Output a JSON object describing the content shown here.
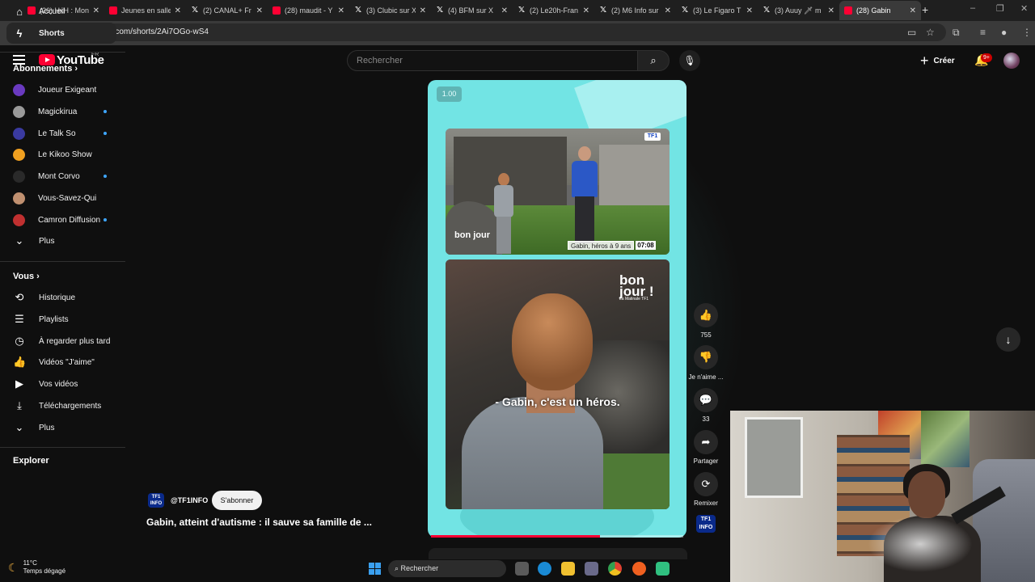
{
  "browser": {
    "tabs": [
      {
        "title": "(26) HxH : Mon",
        "icon": "youtube"
      },
      {
        "title": "Jeunes en salle",
        "icon": "youtube"
      },
      {
        "title": "(2) CANAL+ Fr",
        "icon": "x"
      },
      {
        "title": "(28) maudit - Y",
        "icon": "youtube"
      },
      {
        "title": "(3) Clubic sur X",
        "icon": "x"
      },
      {
        "title": "(4) BFM sur X",
        "icon": "x"
      },
      {
        "title": "(2) Le20h-Fran",
        "icon": "x"
      },
      {
        "title": "(2) M6 Info sur",
        "icon": "x"
      },
      {
        "title": "(3) Le Figaro T",
        "icon": "x"
      },
      {
        "title": "(3) Auuy 🗡 m",
        "icon": "x"
      },
      {
        "title": "(28) Gabin",
        "icon": "youtube",
        "active": true
      }
    ],
    "url": "youtube.com/shorts/2Ai7OGo-wS4"
  },
  "header": {
    "logo_text": "YouTube",
    "country": "FR",
    "search_placeholder": "Rechercher",
    "create_label": "Créer",
    "notif_badge": "9+"
  },
  "sidebar": {
    "main": [
      {
        "label": "Accueil",
        "icon": "home-icon"
      },
      {
        "label": "Shorts",
        "icon": "shorts-icon",
        "active": true
      }
    ],
    "subs_heading": "Abonnements",
    "subscriptions": [
      {
        "label": "Joueur Exigeant",
        "color": "#6a3ac0",
        "dot": false
      },
      {
        "label": "Magickirua",
        "color": "#9a9a9a",
        "dot": true
      },
      {
        "label": "Le Talk So",
        "color": "#3a3aa0",
        "dot": true
      },
      {
        "label": "Le Kikoo Show",
        "color": "#f0a020",
        "dot": false
      },
      {
        "label": "Mont Corvo",
        "color": "#2a2a2a",
        "dot": true
      },
      {
        "label": "Vous-Savez-Qui",
        "color": "#c09070",
        "dot": false
      },
      {
        "label": "Camron Diffusion",
        "color": "#c03030",
        "dot": true
      }
    ],
    "subs_more": "Plus",
    "you_heading": "Vous",
    "you_items": [
      {
        "label": "Historique",
        "icon": "history-icon"
      },
      {
        "label": "Playlists",
        "icon": "playlists-icon"
      },
      {
        "label": "À regarder plus tard",
        "icon": "watch-later-icon"
      },
      {
        "label": "Vidéos \"J'aime\"",
        "icon": "liked-videos-icon"
      },
      {
        "label": "Vos vidéos",
        "icon": "your-videos-icon"
      },
      {
        "label": "Téléchargements",
        "icon": "downloads-icon"
      }
    ],
    "you_more": "Plus",
    "explore_heading": "Explorer"
  },
  "player": {
    "speed": "1.00",
    "subtitle": "- Gabin, c'est un héros.",
    "lower_third_name": "Gabin, héros à 9 ans",
    "lower_third_time": "07:08",
    "tf1_logo": "TF1",
    "bonjour_small": "bon jour",
    "bonjour_big_1": "bon",
    "bonjour_big_2": "jour !",
    "bonjour_sub": "La Matinale TF1",
    "progress": 0.67
  },
  "actions": {
    "likes": "755",
    "dislike_label": "Je n'aime ...",
    "comments": "33",
    "share_label": "Partager",
    "remix_label": "Remixer",
    "channel_logo": "TF1 INFO"
  },
  "channel": {
    "logo": "TF1 INFO",
    "handle": "@TF1INFO",
    "subscribe_label": "S'abonner",
    "short_title": "Gabin, atteint d'autisme : il sauve sa famille de ..."
  },
  "taskbar": {
    "temp": "11°C",
    "weather": "Temps dégagé",
    "search": "Rechercher"
  }
}
